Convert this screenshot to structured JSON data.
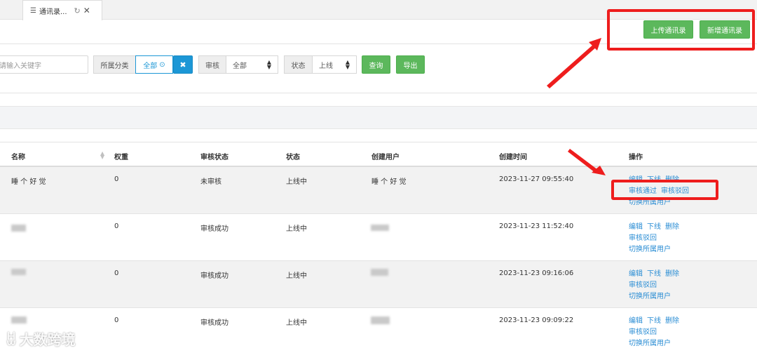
{
  "tab": {
    "title": "通讯录...",
    "icon": "list-icon"
  },
  "header": {
    "upload_label": "上传通讯录",
    "add_label": "新增通讯录"
  },
  "filter": {
    "keyword_placeholder": "请输入关键字",
    "category_label": "所属分类",
    "category_value": "全部",
    "audit_label": "审核",
    "audit_value": "全部",
    "status_label": "状态",
    "status_value": "上线",
    "query_label": "查询",
    "export_label": "导出"
  },
  "table": {
    "headers": [
      "名称",
      "权重",
      "审核状态",
      "状态",
      "创建用户",
      "创建时间",
      "操作"
    ],
    "rows": [
      {
        "name": "睡 个 好 觉",
        "weight": "0",
        "audit": "未审核",
        "status": "上线中",
        "creator": "睡 个 好 觉",
        "time": "2023-11-27 09:55:40",
        "ops": [
          [
            "编辑",
            "下线",
            "删除"
          ],
          [
            "审核通过",
            "审核驳回"
          ],
          [
            "切换所属用户"
          ]
        ]
      },
      {
        "name": "",
        "weight": "0",
        "audit": "审核成功",
        "status": "上线中",
        "creator": "",
        "time": "2023-11-23 11:52:40",
        "ops": [
          [
            "编辑",
            "下线",
            "删除"
          ],
          [
            "审核驳回"
          ],
          [
            "切换所属用户"
          ]
        ]
      },
      {
        "name": "",
        "weight": "0",
        "audit": "审核成功",
        "status": "上线中",
        "creator": "",
        "time": "2023-11-23 09:16:06",
        "ops": [
          [
            "编辑",
            "下线",
            "删除"
          ],
          [
            "审核驳回"
          ],
          [
            "切换所属用户"
          ]
        ]
      },
      {
        "name": "",
        "weight": "0",
        "audit": "审核成功",
        "status": "上线中",
        "creator": "",
        "time": "2023-11-23 09:09:22",
        "ops": [
          [
            "编辑",
            "下线",
            "删除"
          ],
          [
            "审核驳回"
          ],
          [
            "切换所属用户"
          ]
        ]
      }
    ]
  },
  "watermark": "大数跨境",
  "colors": {
    "accent_green": "#5cb85c",
    "accent_blue": "#1c97d6",
    "link": "#2a8dd4",
    "annotation_red": "#ee1d1d"
  }
}
